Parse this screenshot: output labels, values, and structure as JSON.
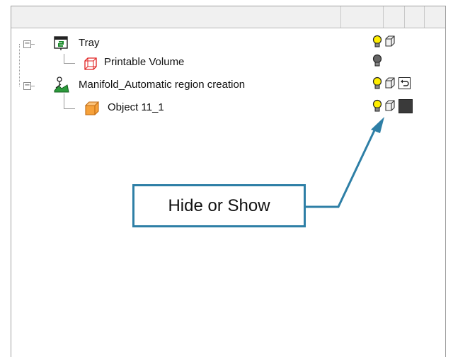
{
  "tree": {
    "items": [
      {
        "label": "Tray",
        "icon": "tray-icon",
        "expander": "−",
        "visible": true
      },
      {
        "label": "Printable Volume",
        "icon": "printable-volume-icon",
        "visible": false
      },
      {
        "label": "Manifold_Automatic region creation",
        "icon": "manifold-icon",
        "expander": "−",
        "visible": true
      },
      {
        "label": "Object 11_1",
        "icon": "object-cube-icon",
        "visible": true
      }
    ]
  },
  "callout": {
    "text": "Hide or Show"
  },
  "colors": {
    "bulb_on": "#ffee00",
    "bulb_off": "#666666",
    "arrow": "#2e7fa6",
    "object": "#f6a13a"
  }
}
